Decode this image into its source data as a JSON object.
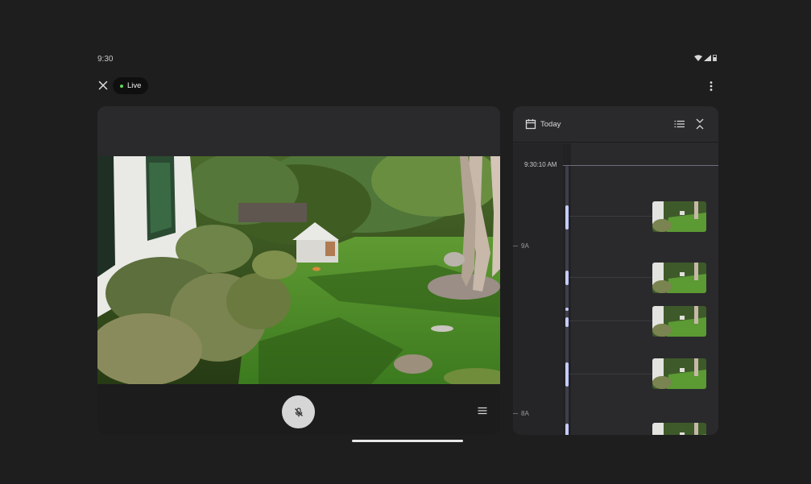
{
  "status_bar": {
    "time": "9:30"
  },
  "header": {
    "live_label": "Live"
  },
  "timeline": {
    "date_label": "Today",
    "current_time_label": "9:30:10 AM",
    "hour_labels": [
      "9A",
      "8A"
    ]
  },
  "colors": {
    "background": "#1e1e1f",
    "panel": "#2a2a2c",
    "live_dot": "#5fd35b",
    "event_accent": "#c5cbff"
  },
  "icons": {
    "close": "close-icon",
    "more": "more-vert-icon",
    "calendar": "calendar-icon",
    "list": "list-icon",
    "collapse": "collapse-icon",
    "mic_off": "mic-off-icon",
    "menu": "menu-icon"
  }
}
